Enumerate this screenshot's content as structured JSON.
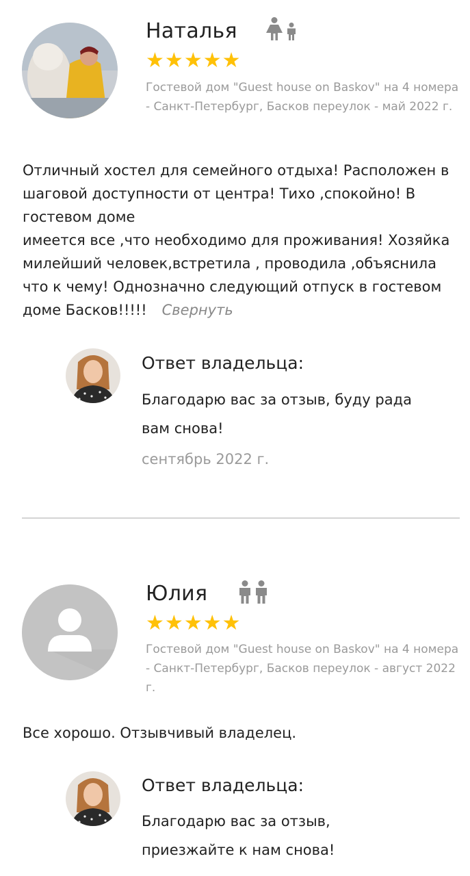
{
  "reviews": [
    {
      "name": "Наталья",
      "guest_icons": [
        "female-icon",
        "child-icon"
      ],
      "rating": 5,
      "meta": "Гостевой дом \"Guest house on Baskov\" на 4 номера - Санкт-Петербург, Басков переулок - май 2022 г.",
      "text": "Отличный хостел для семейного отдыха! Расположен в шаговой доступности от центра! Тихо ,спокойно! В гостевом доме\nимеется все ,что необходимо для проживания! Хозяйка милейший человек,встретила , проводила ,объяснила что к чему! Однозначно следующий отпуск в гостевом доме Басков!!!!!",
      "collapse_label": "Свернуть",
      "reply": {
        "title": "Ответ владельца:",
        "text": "Благодарю вас за отзыв, буду рада вам снова!",
        "date": "сентябрь 2022 г."
      }
    },
    {
      "name": "Юлия",
      "guest_icons": [
        "male-icon",
        "male-icon"
      ],
      "rating": 5,
      "meta": "Гостевой дом \"Guest house on Baskov\" на 4 номера - Санкт-Петербург, Басков переулок - август 2022 г.",
      "text": "Все хорошо. Отзывчивый владелец.",
      "reply": {
        "title": "Ответ владельца:",
        "text": "Благодарю вас за отзыв, приезжайте к нам снова!"
      }
    }
  ],
  "colors": {
    "star": "#ffc107",
    "muted_text": "#9a9a9a",
    "icon_gray": "#8a8a8a",
    "divider": "#d4d4d4"
  }
}
